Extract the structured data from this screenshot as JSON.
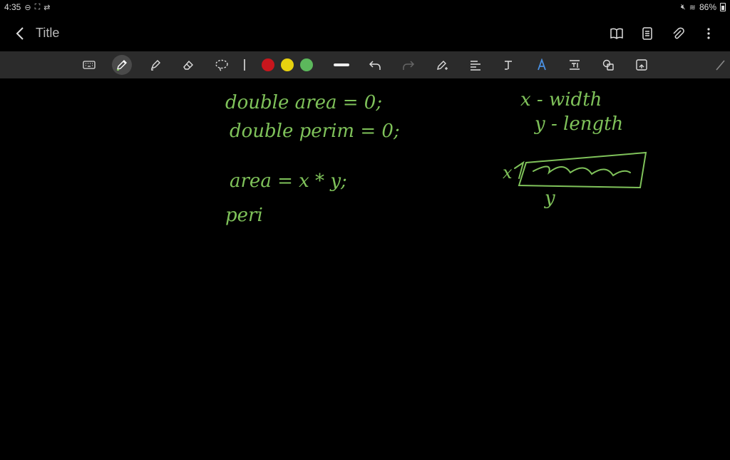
{
  "status_bar": {
    "time": "4:35",
    "battery": "86%"
  },
  "header": {
    "title": "Title"
  },
  "colors": {
    "ink": "#7fc25a",
    "red": "#c8161d",
    "yellow": "#e8d20f",
    "green": "#5cb85c",
    "toolbar_bg": "#2b2b2b"
  },
  "toolbar": {
    "tools": [
      "keyboard-icon",
      "pen-icon",
      "highlighter-icon",
      "eraser-icon",
      "lasso-icon",
      "color-red",
      "color-yellow",
      "color-green",
      "line-thickness",
      "undo-icon",
      "redo-icon",
      "pen-settings-icon",
      "text-align-icon",
      "text-tool-icon",
      "ai-tool-icon",
      "text-box-icon",
      "shapes-icon",
      "insert-image-icon",
      "pencil-icon"
    ]
  },
  "handwriting": {
    "line1": "double area = 0;",
    "line2": "double perim = 0;",
    "line3": "area = x * y;",
    "line4": "peri",
    "note1": "x - width",
    "note2": "y - length",
    "rect_x": "x",
    "rect_y": "y"
  }
}
